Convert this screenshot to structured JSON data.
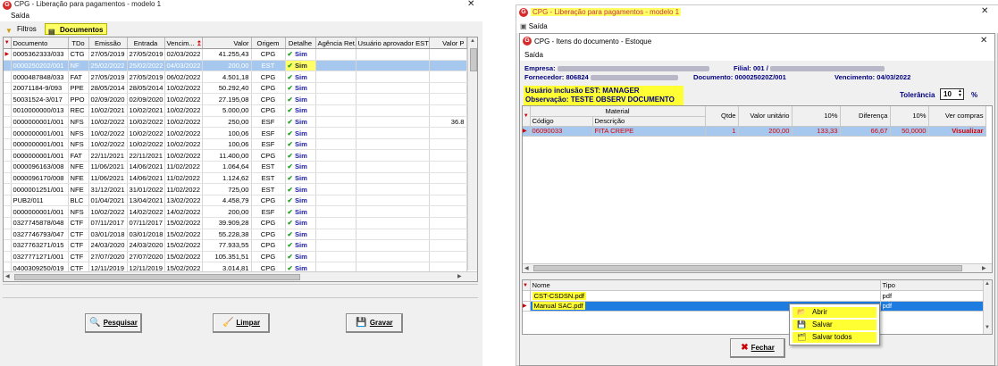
{
  "left_window": {
    "title": "CPG - Liberação para pagamentos - modelo 1",
    "menu": "Saída",
    "tabs": [
      "Filtros",
      "Documentos"
    ],
    "columns": [
      "Documento",
      "TDo",
      "Emissão",
      "Entrada",
      "Vencim...",
      "Valor",
      "Origem",
      "Detalhe",
      "Agência Ret.",
      "Usuário aprovador EST",
      "Valor P"
    ],
    "rows": [
      {
        "doc": "0005362333/033",
        "tdo": "CTG",
        "emissao": "27/05/2019",
        "entrada": "27/05/2019",
        "venc": "02/03/2022",
        "valor": "41.255,43",
        "origem": "CPG",
        "detalhe": "Sim",
        "agencia": "",
        "usuario": "",
        "valorp": ""
      },
      {
        "doc": "0000250202/001",
        "tdo": "NF",
        "emissao": "25/02/2022",
        "entrada": "25/02/2022",
        "venc": "04/03/2022",
        "valor": "200,00",
        "origem": "EST",
        "detalhe": "Sim",
        "agencia": "",
        "usuario": "",
        "valorp": ""
      },
      {
        "doc": "0000487848/033",
        "tdo": "FAT",
        "emissao": "27/05/2019",
        "entrada": "27/05/2019",
        "venc": "06/02/2022",
        "valor": "4.501,18",
        "origem": "CPG",
        "detalhe": "Sim",
        "agencia": "",
        "usuario": "",
        "valorp": ""
      },
      {
        "doc": "20071184-9/093",
        "tdo": "PPE",
        "emissao": "28/05/2014",
        "entrada": "28/05/2014",
        "venc": "10/02/2022",
        "valor": "50.292,40",
        "origem": "CPG",
        "detalhe": "Sim",
        "agencia": "",
        "usuario": "",
        "valorp": ""
      },
      {
        "doc": "50031524-3/017",
        "tdo": "PPO",
        "emissao": "02/09/2020",
        "entrada": "02/09/2020",
        "venc": "10/02/2022",
        "valor": "27.195,08",
        "origem": "CPG",
        "detalhe": "Sim",
        "agencia": "",
        "usuario": "",
        "valorp": ""
      },
      {
        "doc": "0010000000/013",
        "tdo": "REC",
        "emissao": "10/02/2021",
        "entrada": "10/02/2021",
        "venc": "10/02/2022",
        "valor": "5.000,00",
        "origem": "CPG",
        "detalhe": "Sim",
        "agencia": "",
        "usuario": "",
        "valorp": ""
      },
      {
        "doc": "0000000001/001",
        "tdo": "NFS",
        "emissao": "10/02/2022",
        "entrada": "10/02/2022",
        "venc": "10/02/2022",
        "valor": "250,00",
        "origem": "ESF",
        "detalhe": "Sim",
        "agencia": "",
        "usuario": "",
        "valorp": "36.8"
      },
      {
        "doc": "0000000001/001",
        "tdo": "NFS",
        "emissao": "10/02/2022",
        "entrada": "10/02/2022",
        "venc": "10/02/2022",
        "valor": "100,06",
        "origem": "ESF",
        "detalhe": "Sim",
        "agencia": "",
        "usuario": "",
        "valorp": ""
      },
      {
        "doc": "0000000001/001",
        "tdo": "NFS",
        "emissao": "10/02/2022",
        "entrada": "10/02/2022",
        "venc": "10/02/2022",
        "valor": "100,06",
        "origem": "ESF",
        "detalhe": "Sim",
        "agencia": "",
        "usuario": "",
        "valorp": ""
      },
      {
        "doc": "0000000001/001",
        "tdo": "FAT",
        "emissao": "22/11/2021",
        "entrada": "22/11/2021",
        "venc": "10/02/2022",
        "valor": "11.400,00",
        "origem": "CPG",
        "detalhe": "Sim",
        "agencia": "",
        "usuario": "",
        "valorp": ""
      },
      {
        "doc": "0000096163/008",
        "tdo": "NFE",
        "emissao": "11/06/2021",
        "entrada": "14/06/2021",
        "venc": "11/02/2022",
        "valor": "1.064,64",
        "origem": "EST",
        "detalhe": "Sim",
        "agencia": "",
        "usuario": "",
        "valorp": ""
      },
      {
        "doc": "0000096170/008",
        "tdo": "NFE",
        "emissao": "11/06/2021",
        "entrada": "14/06/2021",
        "venc": "11/02/2022",
        "valor": "1.124,62",
        "origem": "EST",
        "detalhe": "Sim",
        "agencia": "",
        "usuario": "",
        "valorp": ""
      },
      {
        "doc": "0000001251/001",
        "tdo": "NFE",
        "emissao": "31/12/2021",
        "entrada": "31/01/2022",
        "venc": "11/02/2022",
        "valor": "725,00",
        "origem": "EST",
        "detalhe": "Sim",
        "agencia": "",
        "usuario": "",
        "valorp": ""
      },
      {
        "doc": "PUB2/011",
        "tdo": "BLC",
        "emissao": "01/04/2021",
        "entrada": "13/04/2021",
        "venc": "13/02/2022",
        "valor": "4.458,79",
        "origem": "CPG",
        "detalhe": "Sim",
        "agencia": "",
        "usuario": "",
        "valorp": ""
      },
      {
        "doc": "0000000001/001",
        "tdo": "NFS",
        "emissao": "10/02/2022",
        "entrada": "14/02/2022",
        "venc": "14/02/2022",
        "valor": "200,00",
        "origem": "ESF",
        "detalhe": "Sim",
        "agencia": "",
        "usuario": "",
        "valorp": ""
      },
      {
        "doc": "0327745878/048",
        "tdo": "CTF",
        "emissao": "07/11/2017",
        "entrada": "07/11/2017",
        "venc": "15/02/2022",
        "valor": "39.909,28",
        "origem": "CPG",
        "detalhe": "Sim",
        "agencia": "",
        "usuario": "",
        "valorp": ""
      },
      {
        "doc": "0327746793/047",
        "tdo": "CTF",
        "emissao": "03/01/2018",
        "entrada": "03/01/2018",
        "venc": "15/02/2022",
        "valor": "55.228,38",
        "origem": "CPG",
        "detalhe": "Sim",
        "agencia": "",
        "usuario": "",
        "valorp": ""
      },
      {
        "doc": "0327763271/015",
        "tdo": "CTF",
        "emissao": "24/03/2020",
        "entrada": "24/03/2020",
        "venc": "15/02/2022",
        "valor": "77.933,55",
        "origem": "CPG",
        "detalhe": "Sim",
        "agencia": "",
        "usuario": "",
        "valorp": ""
      },
      {
        "doc": "0327771271/001",
        "tdo": "CTF",
        "emissao": "27/07/2020",
        "entrada": "27/07/2020",
        "venc": "15/02/2022",
        "valor": "105.351,51",
        "origem": "CPG",
        "detalhe": "Sim",
        "agencia": "",
        "usuario": "",
        "valorp": ""
      },
      {
        "doc": "0400309250/019",
        "tdo": "CTF",
        "emissao": "12/11/2019",
        "entrada": "12/11/2019",
        "venc": "15/02/2022",
        "valor": "3.014,81",
        "origem": "CPG",
        "detalhe": "Sim",
        "agencia": "",
        "usuario": "",
        "valorp": ""
      }
    ],
    "selected_row": 1,
    "buttons": {
      "pesquisar": "Pesquisar",
      "limpar": "Limpar",
      "gravar": "Gravar"
    }
  },
  "right_window": {
    "title": "CPG - Liberação para pagamentos - modelo 1",
    "menu": "Saída"
  },
  "dialog": {
    "title": "CPG - Itens do documento - Estoque",
    "menu": "Saída",
    "empresa_label": "Empresa:",
    "filial_label": "Filial: 001 /",
    "fornecedor_label": "Fornecedor:",
    "fornecedor_value": "806824",
    "documento_label": "Documento:",
    "documento_value": "000025020Z/001",
    "vencimento_label": "Vencimento:",
    "vencimento_value": "04/03/2022",
    "usuario_inclusao": "Usuário inclusão EST: MANAGER",
    "observacao": "Observação: TESTE OBSERV DOCUMENTO",
    "tolerancia_label": "Tolerância",
    "tolerancia_value": "10",
    "tolerancia_unit": "%",
    "items_header_group": "Material",
    "items_columns": [
      "Código",
      "Descrição",
      "Qtde",
      "Valor unitário",
      "10%",
      "Diferença",
      "10%",
      "Ver compras"
    ],
    "items": [
      {
        "codigo": "06090033",
        "descricao": "FITA CREPE",
        "qtde": "1",
        "valor_unit": "200,00",
        "pct1": "133,33",
        "diferenca": "66,67",
        "pct2": "50,0000",
        "ver": "Visualizar"
      }
    ],
    "files_columns": [
      "Nome",
      "Tipo"
    ],
    "files": [
      {
        "nome": "CST-CSDSN.pdf",
        "tipo": "pdf"
      },
      {
        "nome": "Manual SAC.pdf",
        "tipo": "pdf"
      }
    ],
    "fechar_label": "Fechar",
    "context_menu": [
      "Abrir",
      "Salvar",
      "Salvar todos"
    ]
  },
  "colors": {
    "highlight_yellow": "#ffff33",
    "selection_blue": "#a6c8ee",
    "file_selected_blue": "#1e7be0",
    "red_text": "#d00000",
    "navy_text": "#000080"
  }
}
